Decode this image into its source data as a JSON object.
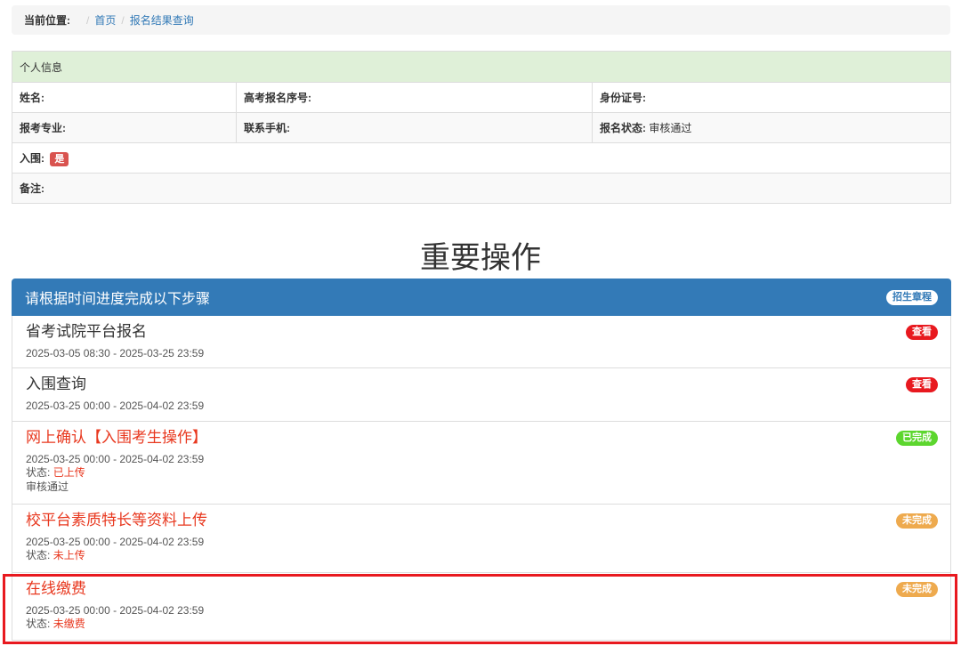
{
  "breadcrumb": {
    "label": "当前位置:",
    "home": "首页",
    "current": "报名结果查询"
  },
  "personal_info": {
    "header": "个人信息",
    "name_label": "姓名:",
    "exam_no_label": "高考报名序号:",
    "id_label": "身份证号:",
    "major_label": "报考专业:",
    "phone_label": "联系手机:",
    "status_label": "报名状态:",
    "status_value": "审核通过",
    "shortlist_label": "入围:",
    "shortlist_value": "是",
    "remark_label": "备注:"
  },
  "section_title": "重要操作",
  "steps_panel": {
    "header": "请根据时间进度完成以下步骤",
    "header_badge": "招生章程",
    "items": [
      {
        "title": "省考试院平台报名",
        "time": "2025-03-05 08:30 - 2025-03-25 23:59",
        "badge": "查看",
        "badge_color": "#e8191f"
      },
      {
        "title": "入围查询",
        "time": "2025-03-25 00:00 - 2025-04-02 23:59",
        "badge": "查看",
        "badge_color": "#e8191f"
      },
      {
        "title": "网上确认【入围考生操作】",
        "time": "2025-03-25 00:00 - 2025-04-02 23:59",
        "status_label": "状态:",
        "status_value": "已上传",
        "note": "审核通过",
        "badge": "已完成",
        "badge_color": "#5cd62e"
      },
      {
        "title": "校平台素质特长等资料上传",
        "time": "2025-03-25 00:00 - 2025-04-02 23:59",
        "status_label": "状态:",
        "status_value": "未上传",
        "badge": "未完成",
        "badge_color": "#eeaa4e"
      },
      {
        "title": "在线缴费",
        "time": "2025-03-25 00:00 - 2025-04-02 23:59",
        "status_label": "状态:",
        "status_value": "未缴费",
        "badge": "未完成",
        "badge_color": "#eeaa4e"
      }
    ]
  },
  "colors": {
    "primary": "#337ab7",
    "success_row": "#dff0d8",
    "danger": "#e8191f",
    "warning": "#eeaa4e",
    "complete": "#5cd62e"
  }
}
